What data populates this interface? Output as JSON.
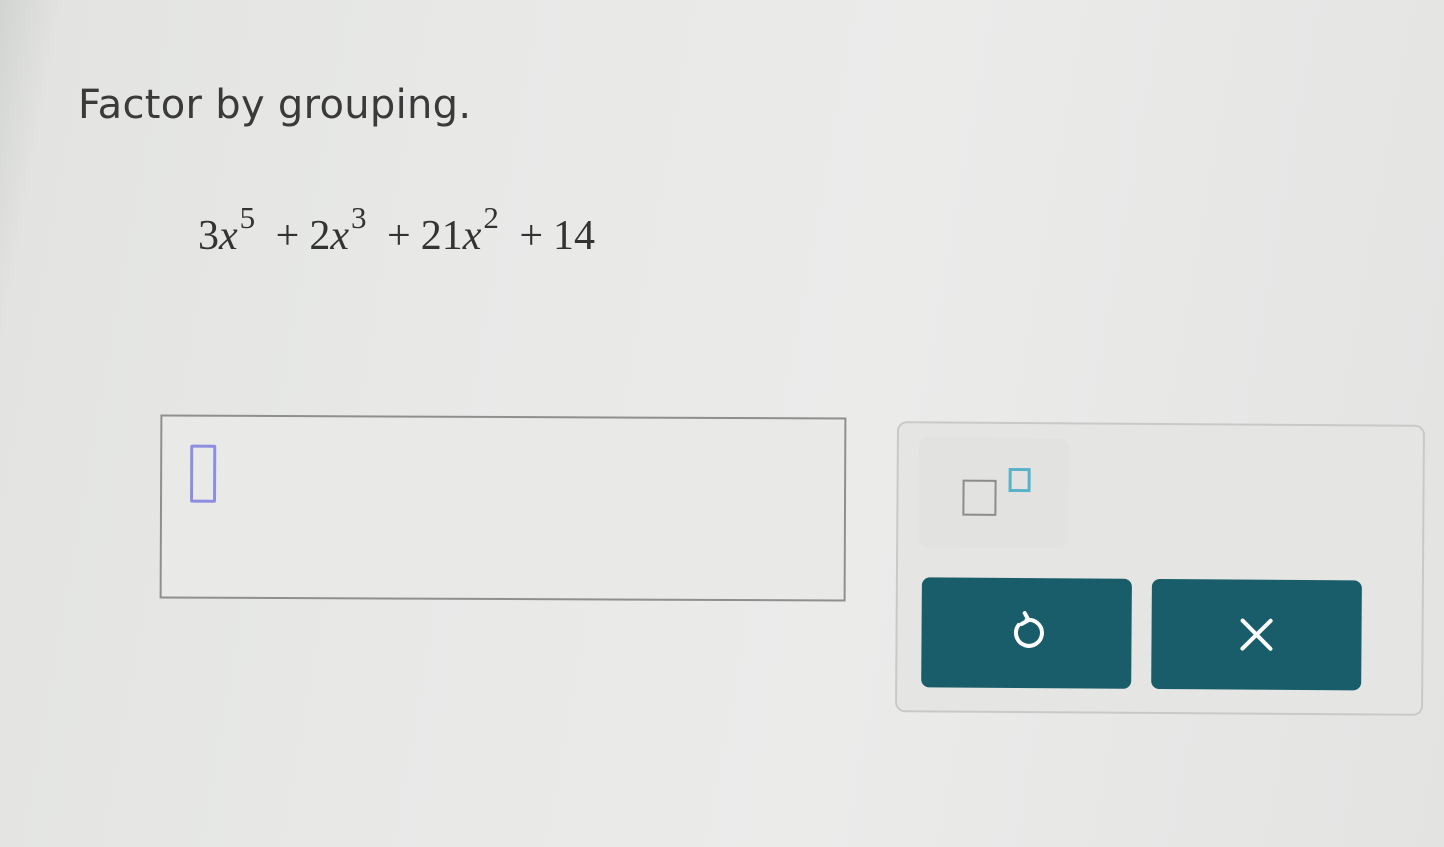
{
  "question": {
    "prompt": "Factor by grouping.",
    "expression": {
      "terms": [
        {
          "coefficient": "3",
          "variable": "x",
          "exponent": "5"
        },
        {
          "operator": "+",
          "coefficient": "2",
          "variable": "x",
          "exponent": "3"
        },
        {
          "operator": "+",
          "coefficient": "21",
          "variable": "x",
          "exponent": "2"
        },
        {
          "operator": "+",
          "constant": "14"
        }
      ]
    }
  },
  "answer": {
    "value": ""
  },
  "toolbar": {
    "buttons": [
      {
        "name": "exponent",
        "icon": "superscript-template-icon"
      },
      {
        "name": "undo",
        "icon": "undo-icon"
      },
      {
        "name": "clear",
        "icon": "close-icon"
      }
    ]
  },
  "colors": {
    "button_bg": "#185d69",
    "cursor_outline": "#8e8ee0",
    "exponent_accent": "#5ab2c8",
    "page_bg": "#e8e9e7"
  }
}
